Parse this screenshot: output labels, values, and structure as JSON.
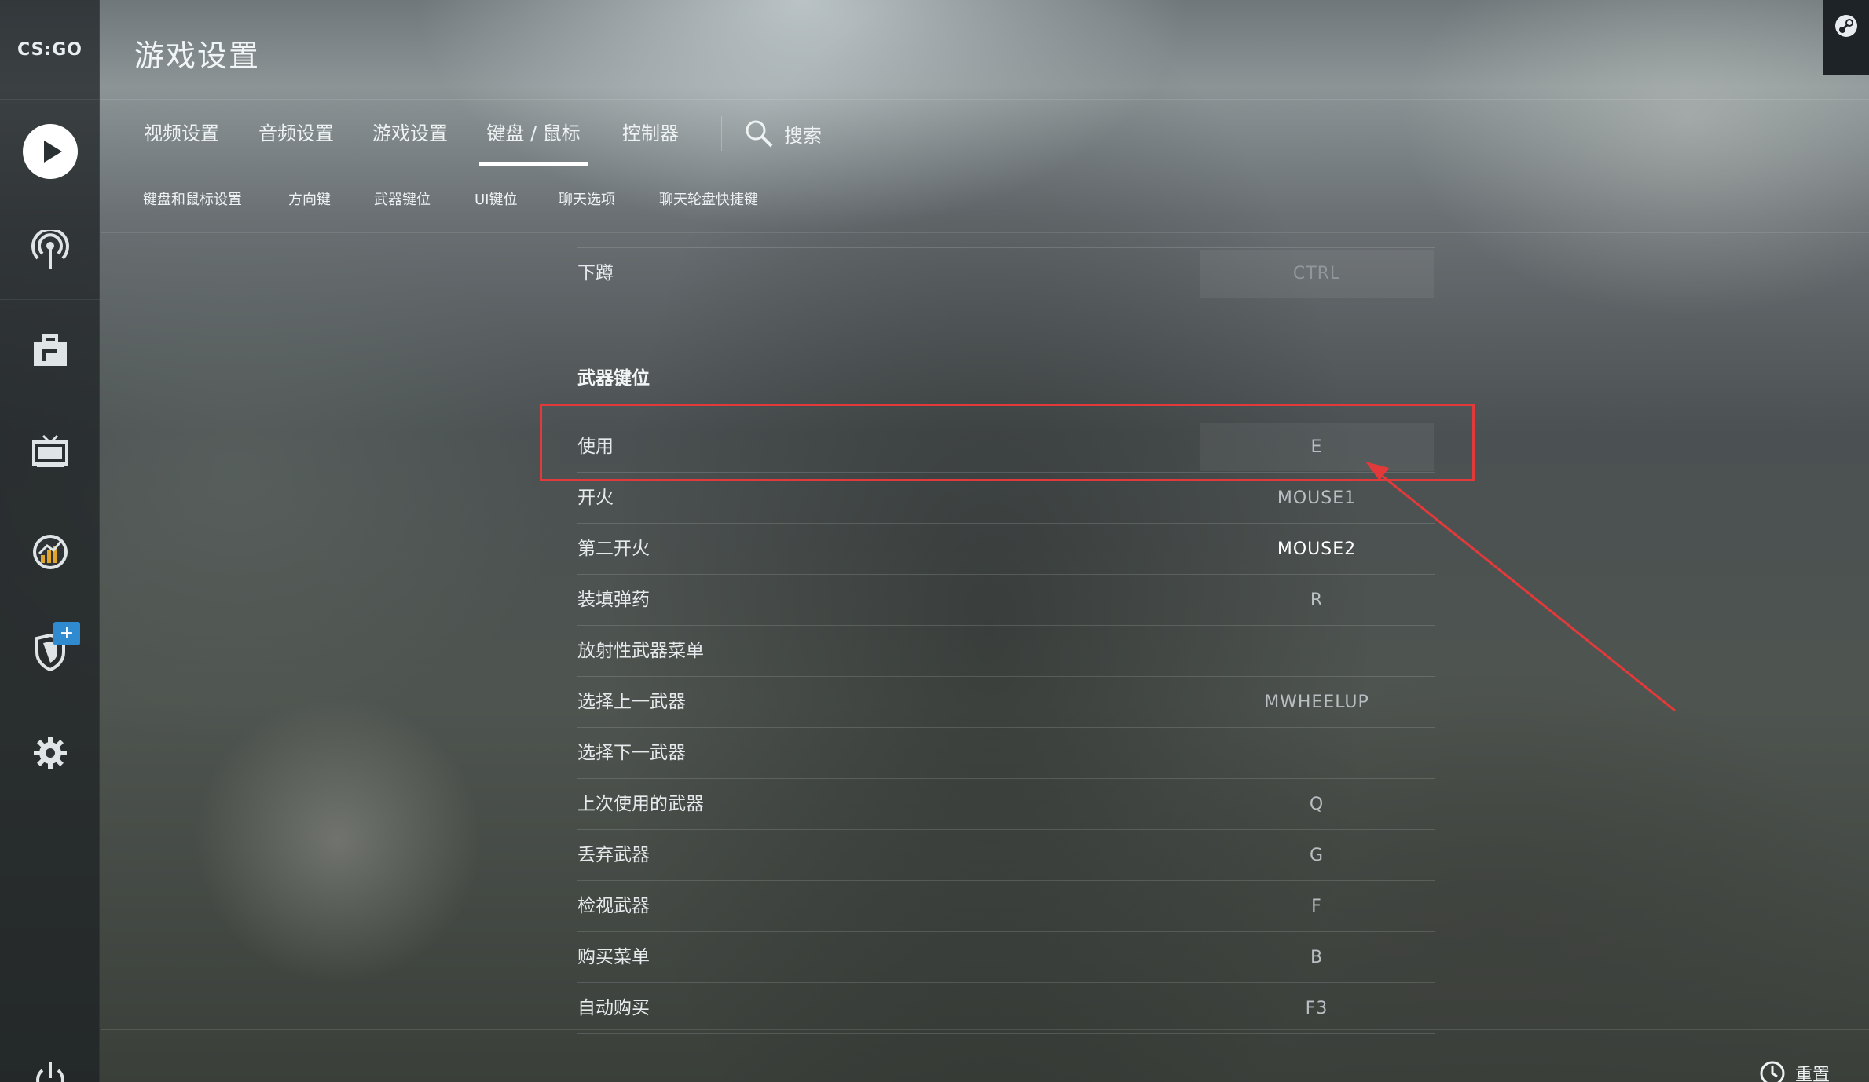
{
  "app": {
    "logo_text": "CS:GO",
    "page_title": "游戏设置"
  },
  "sidebar": {
    "items": [
      {
        "name": "play",
        "icon": "play-icon"
      },
      {
        "name": "watch",
        "icon": "broadcast-icon"
      },
      {
        "name": "inventory",
        "icon": "briefcase-icon"
      },
      {
        "name": "tv",
        "icon": "tv-icon"
      },
      {
        "name": "stats",
        "icon": "stats-icon"
      },
      {
        "name": "operation",
        "icon": "shield-icon",
        "badge": "+"
      },
      {
        "name": "settings",
        "icon": "gear-icon"
      },
      {
        "name": "quit",
        "icon": "power-icon"
      }
    ]
  },
  "tabs": {
    "items": [
      "视频设置",
      "音频设置",
      "游戏设置",
      "键盘 / 鼠标",
      "控制器"
    ],
    "active_index": 3,
    "search_label": "搜索"
  },
  "subtabs": [
    "键盘和鼠标设置",
    "方向键",
    "武器键位",
    "UI键位",
    "聊天选项",
    "聊天轮盘快捷键"
  ],
  "prev_row": {
    "label": "下蹲",
    "key": "CTRL"
  },
  "section_title": "武器键位",
  "rows": [
    {
      "label": "使用",
      "key": "E"
    },
    {
      "label": "开火",
      "key": "MOUSE1"
    },
    {
      "label": "第二开火",
      "key": "MOUSE2"
    },
    {
      "label": "装填弹药",
      "key": "R"
    },
    {
      "label": "放射性武器菜单",
      "key": ""
    },
    {
      "label": "选择上一武器",
      "key": "MWHEELUP"
    },
    {
      "label": "选择下一武器",
      "key": ""
    },
    {
      "label": "上次使用的武器",
      "key": "Q"
    },
    {
      "label": "丢弃武器",
      "key": "G"
    },
    {
      "label": "检视武器",
      "key": "F"
    },
    {
      "label": "购买菜单",
      "key": "B"
    },
    {
      "label": "自动购买",
      "key": "F3"
    }
  ],
  "footer": {
    "reset_label": "重置"
  },
  "colors": {
    "annotation_red": "#e23a3a",
    "badge_blue": "#2f8ad0"
  }
}
